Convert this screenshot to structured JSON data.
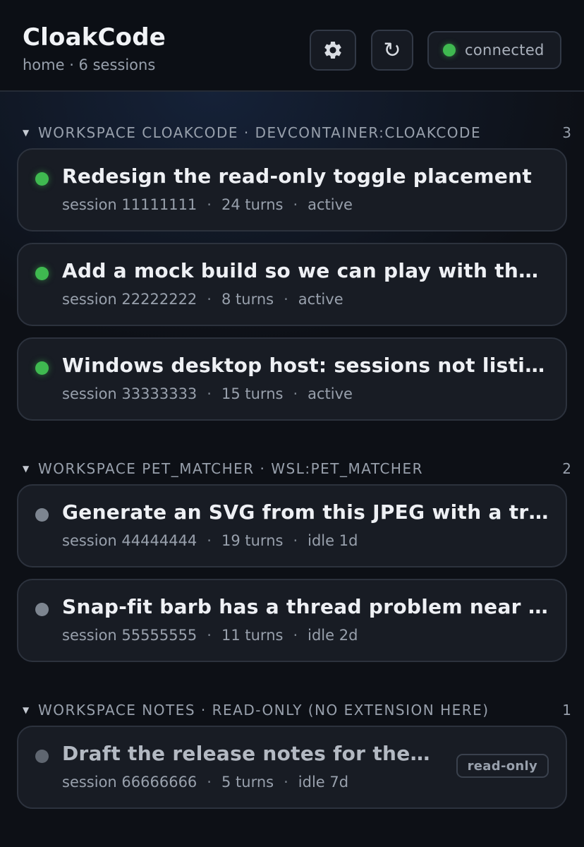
{
  "header": {
    "title": "CloakCode",
    "subtitle": "home · 6 sessions",
    "settings_icon": "gear-icon",
    "refresh_icon": "refresh-icon",
    "refresh_glyph": "↻",
    "connection_status": "connected",
    "connection_color": "#3fb950"
  },
  "groups": [
    {
      "title": "WORKSPACE CLOAKCODE · DEVCONTAINER:CLOAKCODE",
      "count": "3",
      "sessions": [
        {
          "title": "Redesign the read-only toggle placement",
          "session": "session 11111111",
          "turns": "24 turns",
          "status": "active"
        },
        {
          "title": "Add a mock build so we can play with the UI",
          "session": "session 22222222",
          "turns": "8 turns",
          "status": "active"
        },
        {
          "title": "Windows desktop host: sessions not listing",
          "session": "session 33333333",
          "turns": "15 turns",
          "status": "active"
        }
      ]
    },
    {
      "title": "WORKSPACE PET_MATCHER · WSL:PET_MATCHER",
      "count": "2",
      "sessions": [
        {
          "title": "Generate an SVG from this JPEG with a transparent background",
          "session": "session 44444444",
          "turns": "19 turns",
          "status": "idle 1d"
        },
        {
          "title": "Snap-fit barb has a thread problem near the tip",
          "session": "session 55555555",
          "turns": "11 turns",
          "status": "idle 2d"
        }
      ]
    },
    {
      "title": "WORKSPACE NOTES · READ-ONLY (NO EXTENSION HERE)",
      "count": "1",
      "sessions": [
        {
          "title": "Draft the release notes for the next version",
          "session": "session 66666666",
          "turns": "5 turns",
          "status": "idle 7d",
          "badge": "read-only"
        }
      ]
    }
  ],
  "meta_separator": "·",
  "colors": {
    "active": "#3fb950",
    "idle": "#7d8590",
    "background": "#0d1016",
    "card": "#181c24"
  }
}
